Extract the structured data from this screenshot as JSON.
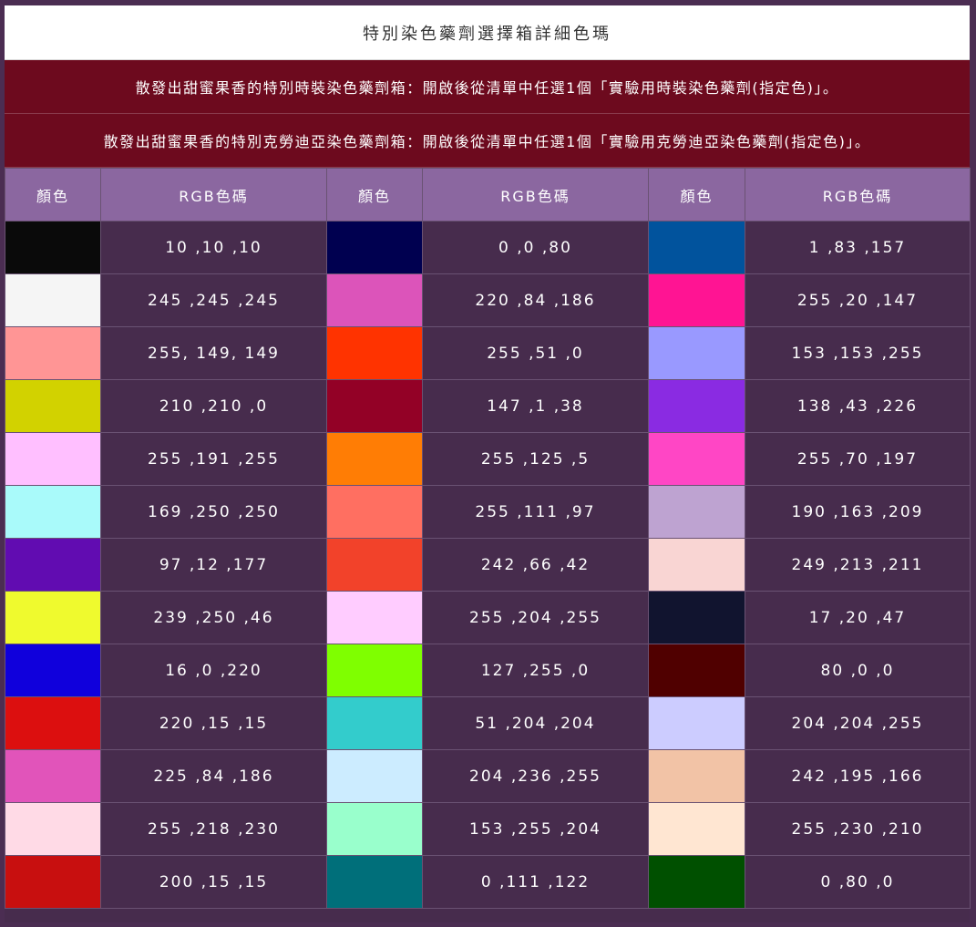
{
  "title": "特別染色藥劑選擇箱詳細色瑪",
  "notices": [
    "散發出甜蜜果香的特別時裝染色藥劑箱：開啟後從清單中任選1個「實驗用時裝染色藥劑(指定色)」。",
    "散發出甜蜜果香的特別克勞迪亞染色藥劑箱：開啟後從清單中任選1個「實驗用克勞迪亞染色藥劑(指定色)」。"
  ],
  "headers": [
    "顏色",
    "RGB色碼",
    "顏色",
    "RGB色碼",
    "顏色",
    "RGB色碼"
  ],
  "rows": [
    [
      {
        "color": "#0a0a0a",
        "rgb": "10 ,10 ,10"
      },
      {
        "color": "#000050",
        "rgb": "0 ,0 ,80"
      },
      {
        "color": "#01539d",
        "rgb": "1 ,83 ,157"
      }
    ],
    [
      {
        "color": "#f5f5f5",
        "rgb": "245 ,245 ,245"
      },
      {
        "color": "#dc54ba",
        "rgb": "220 ,84 ,186"
      },
      {
        "color": "#ff1493",
        "rgb": "255 ,20 ,147"
      }
    ],
    [
      {
        "color": "#ff9595",
        "rgb": "255, 149, 149"
      },
      {
        "color": "#ff3300",
        "rgb": "255 ,51 ,0"
      },
      {
        "color": "#9999ff",
        "rgb": "153 ,153 ,255"
      }
    ],
    [
      {
        "color": "#d2d200",
        "rgb": "210 ,210 ,0"
      },
      {
        "color": "#930126",
        "rgb": "147 ,1 ,38"
      },
      {
        "color": "#8a2be2",
        "rgb": "138 ,43 ,226"
      }
    ],
    [
      {
        "color": "#ffbfff",
        "rgb": "255 ,191 ,255"
      },
      {
        "color": "#ff7d05",
        "rgb": "255 ,125 ,5"
      },
      {
        "color": "#ff46c5",
        "rgb": "255 ,70 ,197"
      }
    ],
    [
      {
        "color": "#a9fafa",
        "rgb": "169 ,250 ,250"
      },
      {
        "color": "#ff6f61",
        "rgb": "255 ,111 ,97"
      },
      {
        "color": "#bea3d1",
        "rgb": "190 ,163 ,209"
      }
    ],
    [
      {
        "color": "#610cb1",
        "rgb": "97 ,12 ,177"
      },
      {
        "color": "#f2422a",
        "rgb": "242 ,66 ,42"
      },
      {
        "color": "#f9d5d3",
        "rgb": "249 ,213 ,211"
      }
    ],
    [
      {
        "color": "#effa2e",
        "rgb": "239 ,250 ,46"
      },
      {
        "color": "#ffccff",
        "rgb": "255 ,204 ,255"
      },
      {
        "color": "#11142f",
        "rgb": "17 ,20 ,47"
      }
    ],
    [
      {
        "color": "#1000dc",
        "rgb": "16 ,0 ,220"
      },
      {
        "color": "#7fff00",
        "rgb": "127 ,255 ,0"
      },
      {
        "color": "#500000",
        "rgb": "80 ,0 ,0"
      }
    ],
    [
      {
        "color": "#dc0f0f",
        "rgb": "220 ,15 ,15"
      },
      {
        "color": "#33cccc",
        "rgb": "51 ,204 ,204"
      },
      {
        "color": "#ccccff",
        "rgb": "204 ,204 ,255"
      }
    ],
    [
      {
        "color": "#e154ba",
        "rgb": "225 ,84 ,186"
      },
      {
        "color": "#ccecff",
        "rgb": "204 ,236 ,255"
      },
      {
        "color": "#f2c3a6",
        "rgb": "242 ,195 ,166"
      }
    ],
    [
      {
        "color": "#ffdae6",
        "rgb": "255 ,218 ,230"
      },
      {
        "color": "#99ffcc",
        "rgb": "153 ,255 ,204"
      },
      {
        "color": "#ffe6d2",
        "rgb": "255 ,230 ,210"
      }
    ],
    [
      {
        "color": "#c80f0f",
        "rgb": "200 ,15 ,15"
      },
      {
        "color": "#006f7a",
        "rgb": "0 ,111 ,122"
      },
      {
        "color": "#005000",
        "rgb": "0 ,80 ,0"
      }
    ]
  ]
}
